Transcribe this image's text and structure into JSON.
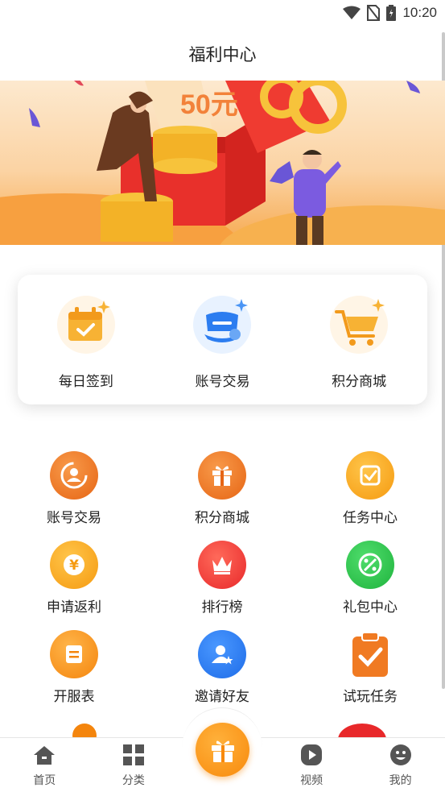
{
  "status_bar": {
    "time": "10:20"
  },
  "header": {
    "title": "福利中心"
  },
  "banner": {
    "text": "50元"
  },
  "features": [
    {
      "label": "每日签到",
      "icon": "calendar-check-icon"
    },
    {
      "label": "账号交易",
      "icon": "account-trade-icon"
    },
    {
      "label": "积分商城",
      "icon": "shopping-cart-icon"
    }
  ],
  "grid": [
    {
      "label": "账号交易",
      "icon": "user-exchange-icon",
      "color": "#f07a22"
    },
    {
      "label": "积分商城",
      "icon": "gift-icon",
      "color": "#f07a22"
    },
    {
      "label": "任务中心",
      "icon": "task-check-icon",
      "color": "#f9a51b"
    },
    {
      "label": "申请返利",
      "icon": "yen-coin-icon",
      "color": "#f9a51b"
    },
    {
      "label": "排行榜",
      "icon": "crown-icon",
      "color": "#f0393a"
    },
    {
      "label": "礼包中心",
      "icon": "coupon-icon",
      "color": "#2dc84d"
    },
    {
      "label": "开服表",
      "icon": "server-list-icon",
      "color": "#f7951d"
    },
    {
      "label": "邀请好友",
      "icon": "invite-user-icon",
      "color": "#2a7df0"
    },
    {
      "label": "试玩任务",
      "icon": "clipboard-check-icon",
      "color": "#f07a22"
    }
  ],
  "tabs": [
    {
      "label": "首页",
      "icon": "home-icon"
    },
    {
      "label": "分类",
      "icon": "category-grid-icon"
    },
    {
      "label": "",
      "icon": "gift-icon"
    },
    {
      "label": "视频",
      "icon": "video-play-icon"
    },
    {
      "label": "我的",
      "icon": "smiley-face-icon"
    }
  ]
}
